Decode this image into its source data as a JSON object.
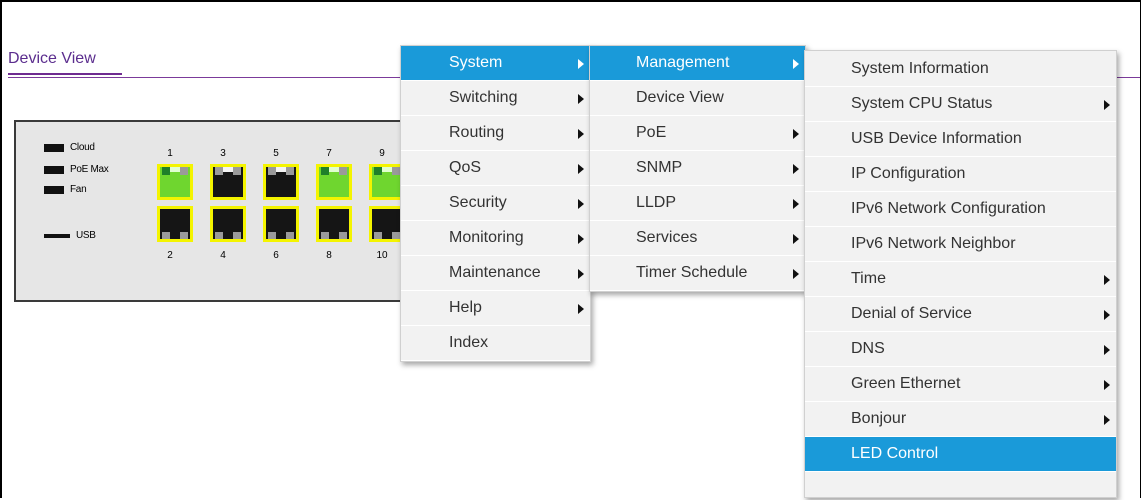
{
  "device_view": {
    "title": "Device View",
    "legend": {
      "cloud": "Cloud",
      "poe_max": "PoE Max",
      "fan": "Fan",
      "usb": "USB"
    },
    "ports_top_labels": [
      "1",
      "3",
      "5",
      "7",
      "9"
    ],
    "ports_bottom_labels": [
      "2",
      "4",
      "6",
      "8",
      "10"
    ],
    "ports_top_link_up": [
      true,
      false,
      false,
      true,
      true
    ],
    "colors": {
      "port_border": "#f4f400",
      "link_up": "#6fd62f",
      "link_down": "#151515"
    }
  },
  "menu_main": {
    "items": [
      {
        "label": "System",
        "has_submenu": true,
        "active": true
      },
      {
        "label": "Switching",
        "has_submenu": true,
        "active": false
      },
      {
        "label": "Routing",
        "has_submenu": true,
        "active": false
      },
      {
        "label": "QoS",
        "has_submenu": true,
        "active": false
      },
      {
        "label": "Security",
        "has_submenu": true,
        "active": false
      },
      {
        "label": "Monitoring",
        "has_submenu": true,
        "active": false
      },
      {
        "label": "Maintenance",
        "has_submenu": true,
        "active": false
      },
      {
        "label": "Help",
        "has_submenu": true,
        "active": false
      },
      {
        "label": "Index",
        "has_submenu": false,
        "active": false
      }
    ]
  },
  "menu_system": {
    "items": [
      {
        "label": "Management",
        "has_submenu": true,
        "active": true
      },
      {
        "label": "Device View",
        "has_submenu": false,
        "active": false
      },
      {
        "label": "PoE",
        "has_submenu": true,
        "active": false
      },
      {
        "label": "SNMP",
        "has_submenu": true,
        "active": false
      },
      {
        "label": "LLDP",
        "has_submenu": true,
        "active": false
      },
      {
        "label": "Services",
        "has_submenu": true,
        "active": false
      },
      {
        "label": "Timer Schedule",
        "has_submenu": true,
        "active": false
      }
    ]
  },
  "menu_management": {
    "items": [
      {
        "label": "System Information",
        "has_submenu": false,
        "active": false
      },
      {
        "label": "System CPU Status",
        "has_submenu": true,
        "active": false
      },
      {
        "label": "USB Device Information",
        "has_submenu": false,
        "active": false
      },
      {
        "label": "IP Configuration",
        "has_submenu": false,
        "active": false
      },
      {
        "label": "IPv6 Network Configuration",
        "has_submenu": false,
        "active": false
      },
      {
        "label": "IPv6 Network Neighbor",
        "has_submenu": false,
        "active": false
      },
      {
        "label": "Time",
        "has_submenu": true,
        "active": false
      },
      {
        "label": "Denial of Service",
        "has_submenu": true,
        "active": false
      },
      {
        "label": "DNS",
        "has_submenu": true,
        "active": false
      },
      {
        "label": "Green Ethernet",
        "has_submenu": true,
        "active": false
      },
      {
        "label": "Bonjour",
        "has_submenu": true,
        "active": false
      },
      {
        "label": "LED Control",
        "has_submenu": false,
        "active": true
      }
    ]
  },
  "colors": {
    "menu_active": "#1a9ad9",
    "menu_bg": "#f2f2f2",
    "title_purple": "#5b2d8e"
  }
}
